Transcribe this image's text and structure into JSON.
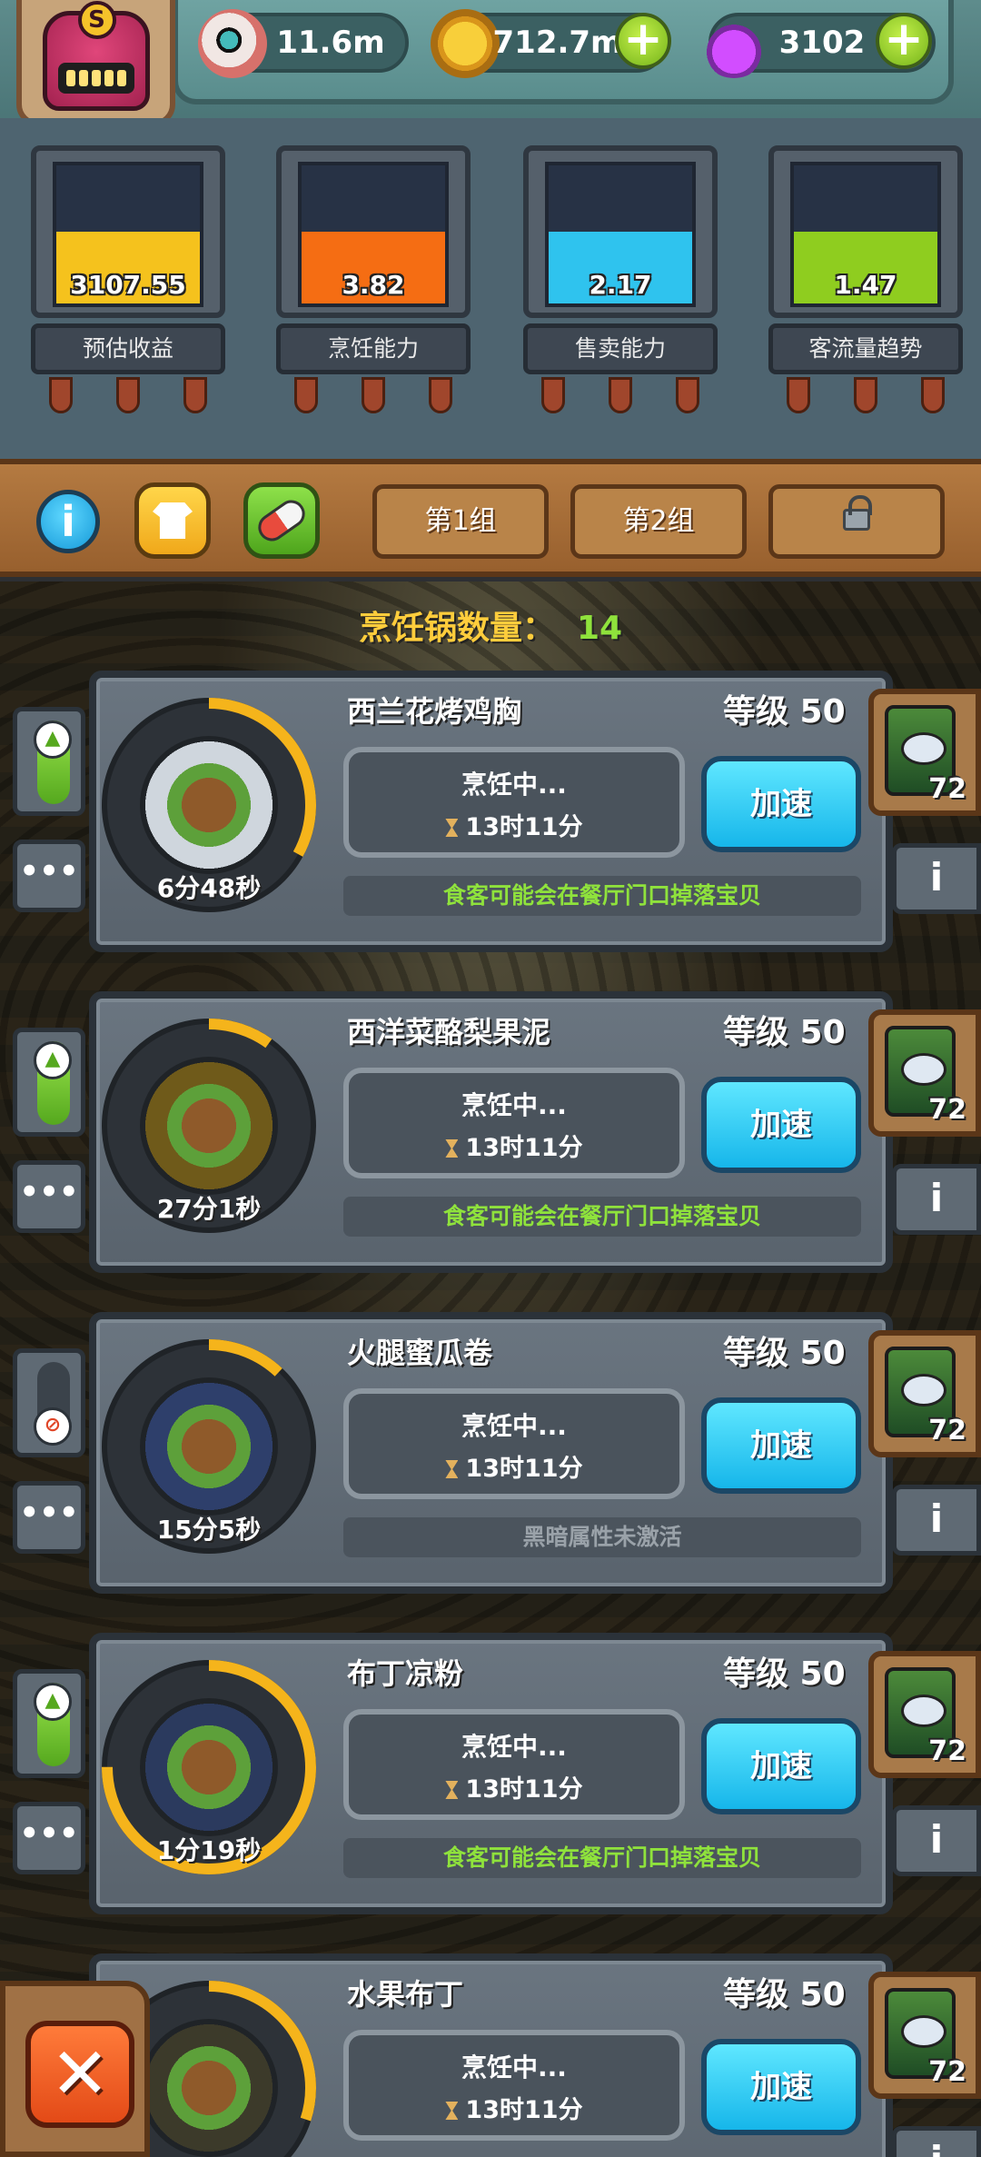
{
  "header": {
    "eyeballs": "11.6m",
    "coins": "712.7m",
    "potions": "3102",
    "avatar_badge": "S",
    "icons": [
      "eyeball-icon",
      "coin-icon",
      "potion-icon",
      "plus-icon"
    ]
  },
  "stats": [
    {
      "value": "3107.55",
      "label": "预估收益",
      "color": "#f5c21d",
      "fill": 0.52
    },
    {
      "value": "3.82",
      "label": "烹饪能力",
      "color": "#f56d13",
      "fill": 0.52
    },
    {
      "value": "2.17",
      "label": "售卖能力",
      "color": "#2fc3ee",
      "fill": 0.52
    },
    {
      "value": "1.47",
      "label": "客流量趋势",
      "color": "#8fcd1f",
      "fill": 0.52
    }
  ],
  "groups": {
    "tab1": "第1组",
    "tab2": "第2组",
    "locked_icon": "lock-icon"
  },
  "pot_count": {
    "label": "烹饪锅数量：",
    "value": "14"
  },
  "recipes": [
    {
      "name": "西兰花烤鸡胸",
      "level": "等级 50",
      "status": "烹饪中...",
      "remaining": "13时11分",
      "timer": "6分48秒",
      "note": "食客可能会在餐厅门口掉落宝贝",
      "note_type": "green",
      "reward_count": "72",
      "toggle": "on",
      "progress": 0.33,
      "plate": "#cfd6dd"
    },
    {
      "name": "西洋菜酪梨果泥",
      "level": "等级 50",
      "status": "烹饪中...",
      "remaining": "13时11分",
      "timer": "27分1秒",
      "note": "食客可能会在餐厅门口掉落宝贝",
      "note_type": "green",
      "reward_count": "72",
      "toggle": "on",
      "progress": 0.1,
      "plate": "#6f5a1a"
    },
    {
      "name": "火腿蜜瓜卷",
      "level": "等级 50",
      "status": "烹饪中...",
      "remaining": "13时11分",
      "timer": "15分5秒",
      "note": "黑暗属性未激活",
      "note_type": "gray",
      "reward_count": "72",
      "toggle": "off",
      "progress": 0.12,
      "plate": "#2e3f6b"
    },
    {
      "name": "布丁凉粉",
      "level": "等级 50",
      "status": "烹饪中...",
      "remaining": "13时11分",
      "timer": "1分19秒",
      "note": "食客可能会在餐厅门口掉落宝贝",
      "note_type": "green",
      "reward_count": "72",
      "toggle": "on",
      "progress": 0.75,
      "plate": "#2b3a5e"
    },
    {
      "name": "水果布丁",
      "level": "等级 50",
      "status": "烹饪中...",
      "remaining": "13时11分",
      "timer": "",
      "note": "",
      "note_type": "green",
      "reward_count": "72",
      "toggle": "on",
      "progress": 0.3,
      "plate": "#3c3a2a"
    }
  ],
  "buttons": {
    "speed": "加速",
    "more": "•••",
    "info": "i",
    "close": "✕"
  }
}
